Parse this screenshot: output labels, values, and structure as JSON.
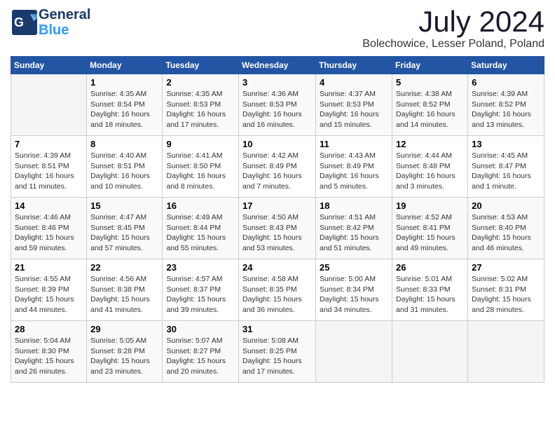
{
  "header": {
    "logo_general": "General",
    "logo_blue": "Blue",
    "title": "July 2024",
    "subtitle": "Bolechowice, Lesser Poland, Poland"
  },
  "calendar": {
    "days_of_week": [
      "Sunday",
      "Monday",
      "Tuesday",
      "Wednesday",
      "Thursday",
      "Friday",
      "Saturday"
    ],
    "weeks": [
      [
        {
          "day": "",
          "info": ""
        },
        {
          "day": "1",
          "info": "Sunrise: 4:35 AM\nSunset: 8:54 PM\nDaylight: 16 hours\nand 18 minutes."
        },
        {
          "day": "2",
          "info": "Sunrise: 4:35 AM\nSunset: 8:53 PM\nDaylight: 16 hours\nand 17 minutes."
        },
        {
          "day": "3",
          "info": "Sunrise: 4:36 AM\nSunset: 8:53 PM\nDaylight: 16 hours\nand 16 minutes."
        },
        {
          "day": "4",
          "info": "Sunrise: 4:37 AM\nSunset: 8:53 PM\nDaylight: 16 hours\nand 15 minutes."
        },
        {
          "day": "5",
          "info": "Sunrise: 4:38 AM\nSunset: 8:52 PM\nDaylight: 16 hours\nand 14 minutes."
        },
        {
          "day": "6",
          "info": "Sunrise: 4:39 AM\nSunset: 8:52 PM\nDaylight: 16 hours\nand 13 minutes."
        }
      ],
      [
        {
          "day": "7",
          "info": "Sunrise: 4:39 AM\nSunset: 8:51 PM\nDaylight: 16 hours\nand 11 minutes."
        },
        {
          "day": "8",
          "info": "Sunrise: 4:40 AM\nSunset: 8:51 PM\nDaylight: 16 hours\nand 10 minutes."
        },
        {
          "day": "9",
          "info": "Sunrise: 4:41 AM\nSunset: 8:50 PM\nDaylight: 16 hours\nand 8 minutes."
        },
        {
          "day": "10",
          "info": "Sunrise: 4:42 AM\nSunset: 8:49 PM\nDaylight: 16 hours\nand 7 minutes."
        },
        {
          "day": "11",
          "info": "Sunrise: 4:43 AM\nSunset: 8:49 PM\nDaylight: 16 hours\nand 5 minutes."
        },
        {
          "day": "12",
          "info": "Sunrise: 4:44 AM\nSunset: 8:48 PM\nDaylight: 16 hours\nand 3 minutes."
        },
        {
          "day": "13",
          "info": "Sunrise: 4:45 AM\nSunset: 8:47 PM\nDaylight: 16 hours\nand 1 minute."
        }
      ],
      [
        {
          "day": "14",
          "info": "Sunrise: 4:46 AM\nSunset: 8:46 PM\nDaylight: 15 hours\nand 59 minutes."
        },
        {
          "day": "15",
          "info": "Sunrise: 4:47 AM\nSunset: 8:45 PM\nDaylight: 15 hours\nand 57 minutes."
        },
        {
          "day": "16",
          "info": "Sunrise: 4:49 AM\nSunset: 8:44 PM\nDaylight: 15 hours\nand 55 minutes."
        },
        {
          "day": "17",
          "info": "Sunrise: 4:50 AM\nSunset: 8:43 PM\nDaylight: 15 hours\nand 53 minutes."
        },
        {
          "day": "18",
          "info": "Sunrise: 4:51 AM\nSunset: 8:42 PM\nDaylight: 15 hours\nand 51 minutes."
        },
        {
          "day": "19",
          "info": "Sunrise: 4:52 AM\nSunset: 8:41 PM\nDaylight: 15 hours\nand 49 minutes."
        },
        {
          "day": "20",
          "info": "Sunrise: 4:53 AM\nSunset: 8:40 PM\nDaylight: 15 hours\nand 46 minutes."
        }
      ],
      [
        {
          "day": "21",
          "info": "Sunrise: 4:55 AM\nSunset: 8:39 PM\nDaylight: 15 hours\nand 44 minutes."
        },
        {
          "day": "22",
          "info": "Sunrise: 4:56 AM\nSunset: 8:38 PM\nDaylight: 15 hours\nand 41 minutes."
        },
        {
          "day": "23",
          "info": "Sunrise: 4:57 AM\nSunset: 8:37 PM\nDaylight: 15 hours\nand 39 minutes."
        },
        {
          "day": "24",
          "info": "Sunrise: 4:58 AM\nSunset: 8:35 PM\nDaylight: 15 hours\nand 36 minutes."
        },
        {
          "day": "25",
          "info": "Sunrise: 5:00 AM\nSunset: 8:34 PM\nDaylight: 15 hours\nand 34 minutes."
        },
        {
          "day": "26",
          "info": "Sunrise: 5:01 AM\nSunset: 8:33 PM\nDaylight: 15 hours\nand 31 minutes."
        },
        {
          "day": "27",
          "info": "Sunrise: 5:02 AM\nSunset: 8:31 PM\nDaylight: 15 hours\nand 28 minutes."
        }
      ],
      [
        {
          "day": "28",
          "info": "Sunrise: 5:04 AM\nSunset: 8:30 PM\nDaylight: 15 hours\nand 26 minutes."
        },
        {
          "day": "29",
          "info": "Sunrise: 5:05 AM\nSunset: 8:28 PM\nDaylight: 15 hours\nand 23 minutes."
        },
        {
          "day": "30",
          "info": "Sunrise: 5:07 AM\nSunset: 8:27 PM\nDaylight: 15 hours\nand 20 minutes."
        },
        {
          "day": "31",
          "info": "Sunrise: 5:08 AM\nSunset: 8:25 PM\nDaylight: 15 hours\nand 17 minutes."
        },
        {
          "day": "",
          "info": ""
        },
        {
          "day": "",
          "info": ""
        },
        {
          "day": "",
          "info": ""
        }
      ]
    ]
  }
}
